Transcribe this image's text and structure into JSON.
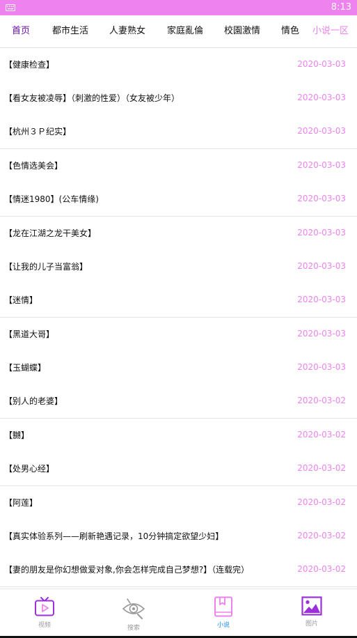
{
  "status_bar": {
    "time": "8:13",
    "left_icon": "keyboard-icon",
    "bg_color": "#ee82ee"
  },
  "tabs": [
    {
      "label": "首页",
      "active": true
    },
    {
      "label": "都市生活",
      "active": false
    },
    {
      "label": "人妻熟女",
      "active": false
    },
    {
      "label": "家庭亂倫",
      "active": false
    },
    {
      "label": "校園激情",
      "active": false
    },
    {
      "label": "情色",
      "active": false
    }
  ],
  "more_tab": {
    "label": "小说一区",
    "color": "#ee82ee"
  },
  "list": [
    {
      "title": "【健康检查】",
      "date": "2020-03-03"
    },
    {
      "title": "【看女友被凌辱】（刺激的性爱）（女友被少年）",
      "date": "2020-03-03"
    },
    {
      "title": "【杭州３Ｐ纪实】",
      "date": "2020-03-03"
    },
    {
      "title": "【色情选美会】",
      "date": "2020-03-03"
    },
    {
      "title": "【情迷1980】(公车情缘)",
      "date": "2020-03-03"
    },
    {
      "title": "【龙在江湖之龙干美女】",
      "date": "2020-03-03"
    },
    {
      "title": "【让我的儿子当富翁】",
      "date": "2020-03-03"
    },
    {
      "title": "【迷情】",
      "date": "2020-03-03"
    },
    {
      "title": "【黑道大哥】",
      "date": "2020-03-03"
    },
    {
      "title": "【玉蝴蝶】",
      "date": "2020-03-03"
    },
    {
      "title": "【别人的老婆】",
      "date": "2020-03-02"
    },
    {
      "title": "【嬲】",
      "date": "2020-03-02"
    },
    {
      "title": "【处男心经】",
      "date": "2020-03-02"
    },
    {
      "title": "【阿莲】",
      "date": "2020-03-02"
    },
    {
      "title": "【真实体验系列——刷新艳遇记录，10分钟搞定欲望少妇】",
      "date": "2020-03-02"
    },
    {
      "title": "【妻的朋友是你幻想做爱对象,你会怎样完成自己梦想?】（连载完）",
      "date": "2020-03-02"
    }
  ],
  "bottom_nav": [
    {
      "label": "视频",
      "icon": "tv-play-icon",
      "active": false
    },
    {
      "label": "搜索",
      "icon": "search-eye-icon",
      "active": false
    },
    {
      "label": "小说",
      "icon": "book-icon",
      "active": true
    },
    {
      "label": "图片",
      "icon": "image-icon",
      "active": false
    }
  ],
  "colors": {
    "accent": "#ee82ee",
    "active_tab": "#6a0dad",
    "active_nav_label": "#1e90ff",
    "icon_purple": "#9b30d9"
  }
}
